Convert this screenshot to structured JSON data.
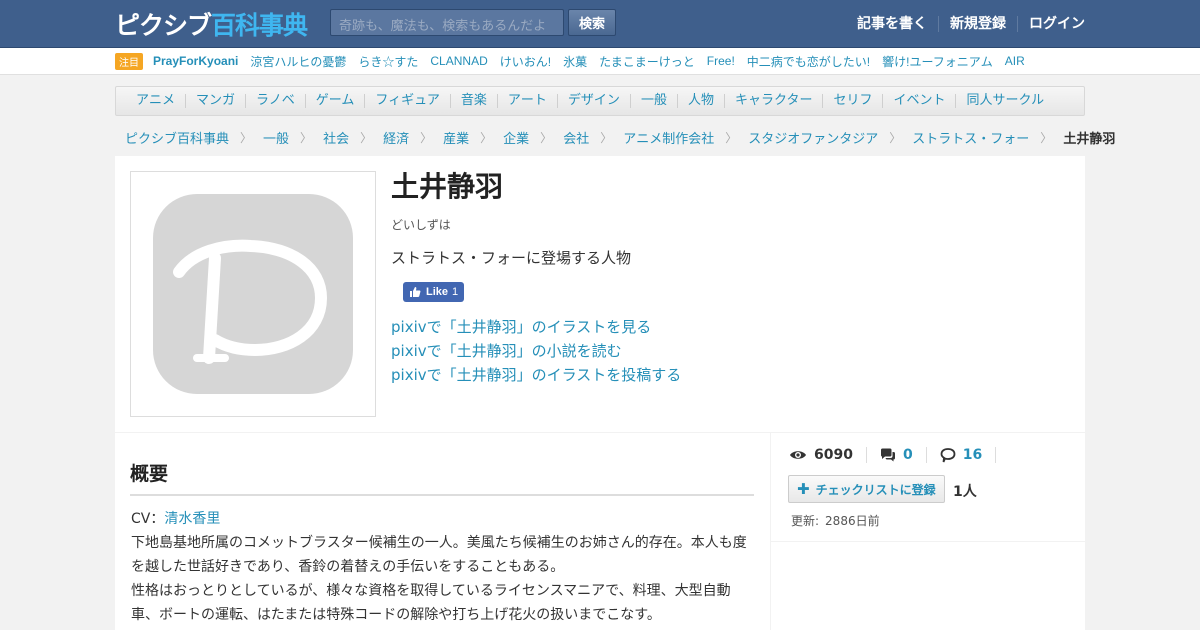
{
  "header": {
    "logo_part1": "ピクシブ",
    "logo_part2": "百科事典",
    "search_placeholder": "奇跡も、魔法も、検索もあるんだよ",
    "search_button": "検索",
    "nav": [
      "記事を書く",
      "新規登録",
      "ログイン"
    ]
  },
  "trending": {
    "badge": "注目",
    "items": [
      "PrayForKyoani",
      "涼宮ハルヒの憂鬱",
      "らき☆すた",
      "CLANNAD",
      "けいおん!",
      "氷菓",
      "たまこまーけっと",
      "Free!",
      "中二病でも恋がしたい!",
      "響け!ユーフォニアム",
      "AIR"
    ]
  },
  "categories": [
    "アニメ",
    "マンガ",
    "ラノベ",
    "ゲーム",
    "フィギュア",
    "音楽",
    "アート",
    "デザイン",
    "一般",
    "人物",
    "キャラクター",
    "セリフ",
    "イベント",
    "同人サークル"
  ],
  "breadcrumb": [
    "ピクシブ百科事典",
    "一般",
    "社会",
    "経済",
    "産業",
    "企業",
    "会社",
    "アニメ制作会社",
    "スタジオファンタジア",
    "ストラトス・フォー"
  ],
  "breadcrumb_sep": "〉",
  "breadcrumb_current": "土井静羽",
  "article": {
    "title": "土井静羽",
    "reading": "どいしずは",
    "summary": "ストラトス・フォーに登場する人物",
    "like_label": "Like",
    "like_count": "1",
    "pixiv_links": [
      "pixivで「土井静羽」のイラストを見る",
      "pixivで「土井静羽」の小説を読む",
      "pixivで「土井静羽」のイラストを投稿する"
    ]
  },
  "content": {
    "heading": "概要",
    "cv_label": "CV：",
    "cv_name": "清水香里",
    "paragraphs": [
      "下地島基地所属のコメットブラスター候補生の一人。美風たち候補生のお姉さん的存在。本人も度を越した世話好きであり、香鈴の着替えの手伝いをすることもある。",
      "性格はおっとりとしているが、様々な資格を取得しているライセンスマニアで、料理、大型自動車、ボートの運転、はたまたは特殊コードの解除や打ち上げ花火の扱いまでこなす。"
    ]
  },
  "sidebar": {
    "views": "6090",
    "comments": "0",
    "tags": "16",
    "checklist_label": "チェックリストに登録",
    "checklist_count": "1人",
    "updated_label": "更新:",
    "updated_value": "2886日前"
  },
  "colors": {
    "header_bg": "#3f5f8c",
    "link": "#258fb8",
    "logo_accent": "#3fb6f0",
    "badge": "#f5a623",
    "facebook": "#4267b2"
  }
}
